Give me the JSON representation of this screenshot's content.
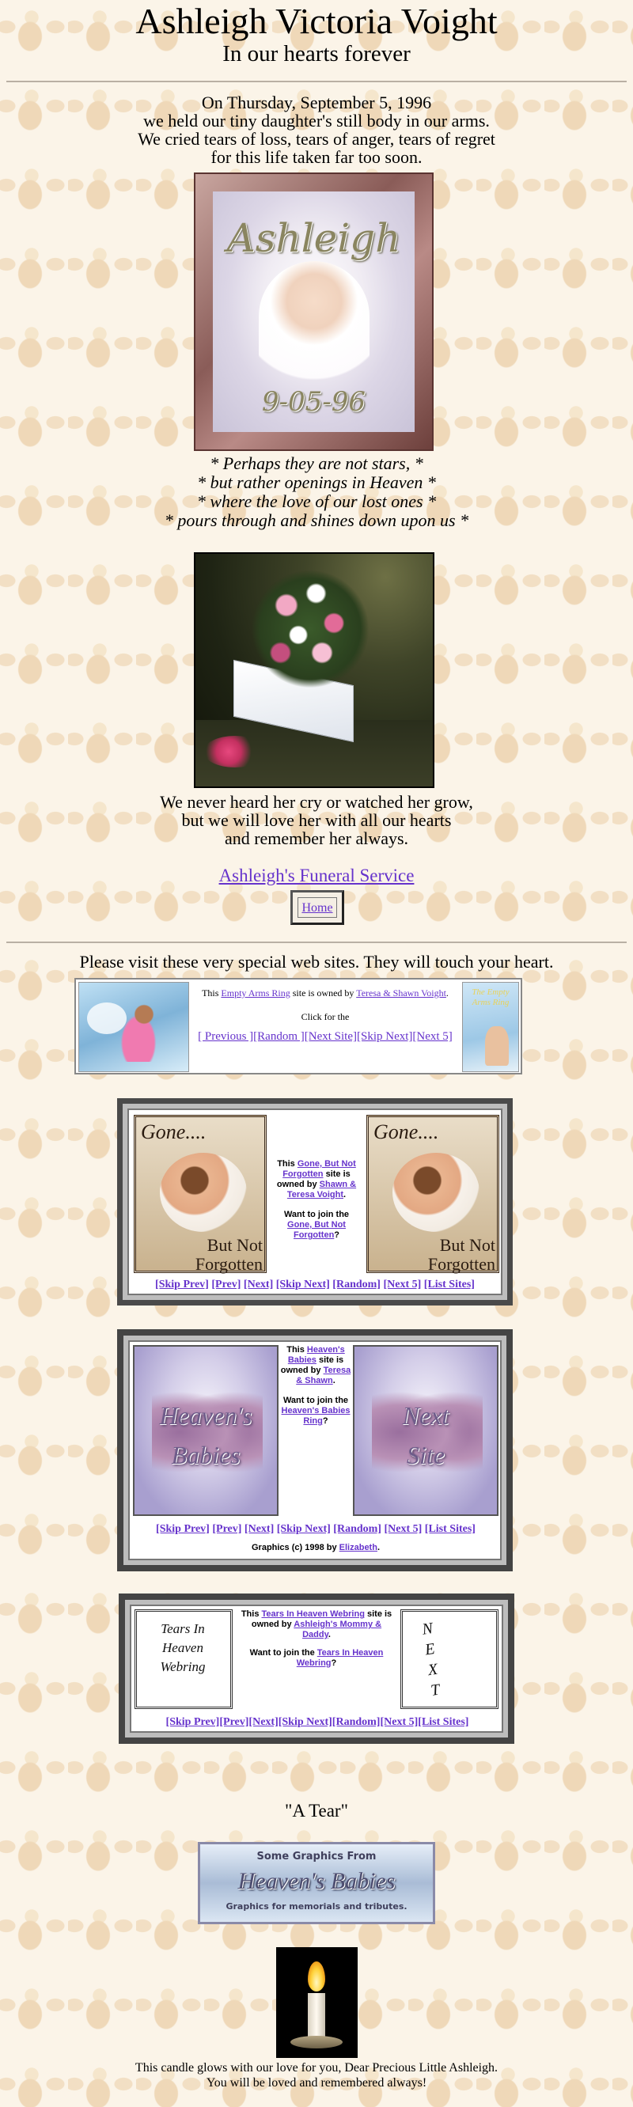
{
  "header": {
    "title": "Ashleigh Victoria Voight",
    "subtitle": "In our hearts forever"
  },
  "intro": {
    "line1": "On Thursday, September 5, 1996",
    "line2": "we held our tiny daughter's still body in our arms.",
    "line3": "We cried tears of loss, tears of anger, tears of regret",
    "line4": "for this life taken far too soon."
  },
  "portrait": {
    "name": "Ashleigh",
    "date": "9-05-96"
  },
  "poem": {
    "line1": "* Perhaps they are not stars, *",
    "line2": "* but rather openings in Heaven *",
    "line3": "* where the love of our lost ones *",
    "line4": "* pours through and shines down upon us *"
  },
  "closing": {
    "line1": "We never heard her cry or watched her grow,",
    "line2": "but we will love her with all our hearts",
    "line3": "and remember her always."
  },
  "funeral_link": "Ashleigh's Funeral Service",
  "home_button": "Home",
  "visit_text": "Please visit these very special web sites. They will touch your heart.",
  "ring1": {
    "pre": "This ",
    "ring_name": "Empty Arms Ring",
    "mid": " site is owned by ",
    "owner": "Teresa & Shawn Voight",
    "post": ".",
    "click": "Click for the",
    "nav": [
      "[ Previous ]",
      "[Random ]",
      "[Next Site]",
      "[Skip Next]",
      "[Next 5]"
    ],
    "right_image_text": "The Empty Arms Ring"
  },
  "ring2": {
    "left_top": "Gone....",
    "left_bottom": "But Not Forgotten",
    "right_top": "Gone....",
    "right_bottom": "But Not Forgotten",
    "t1": "This ",
    "ring_name": "Gone, But Not Forgotten",
    "t2": " site is owned by ",
    "owner": "Shawn & Teresa Voight",
    "t3": ".",
    "join_pre": "Want to join the ",
    "join_link": "Gone, But Not Forgotten",
    "join_post": "?",
    "nav": [
      "[Skip Prev]",
      "[Prev]",
      "[Next]",
      "[Skip Next]",
      "[Random]",
      "[Next 5]",
      "[List Sites]"
    ]
  },
  "ring3": {
    "left_image_text": "Heaven's Babies",
    "right_image_text": "Next Site",
    "t1": "This ",
    "ring_name": "Heaven's Babies",
    "t2": " site is owned by ",
    "owner": "Teresa & Shawn",
    "t3": ".",
    "join_pre": "Want to join the ",
    "join_link": "Heaven's Babies Ring",
    "join_post": "?",
    "nav": [
      "[Skip Prev]",
      "[Prev]",
      "[Next]",
      "[Skip Next]",
      "[Random]",
      "[Next 5]",
      "[List Sites]"
    ],
    "credit_pre": "Graphics (c) 1998 by ",
    "credit_link": "Elizabeth",
    "credit_post": "."
  },
  "ring4": {
    "left_image_text": "Tears In Heaven Webring",
    "right_image_text": "N E X T",
    "t1": "This ",
    "ring_name": "Tears In Heaven Webring",
    "t2": " site is owned by ",
    "owner": "Ashleigh's Mommy & Daddy",
    "t3": ".",
    "join_pre": "Want to join the ",
    "join_link": "Tears In Heaven Webring",
    "join_post": "?",
    "nav": [
      "[Skip Prev]",
      "[Prev]",
      "[Next]",
      "[Skip Next]",
      "[Random]",
      "[Next 5]",
      "[List Sites]"
    ]
  },
  "tear_title": "\"A Tear\"",
  "banner": {
    "line1": "Some Graphics From",
    "line2": "Heaven's Babies",
    "line3": "Graphics for memorials and tributes."
  },
  "footer": {
    "line1": "This candle glows with our love for you, Dear Precious Little Ashleigh.",
    "line2": "You will be loved and remembered always!"
  }
}
